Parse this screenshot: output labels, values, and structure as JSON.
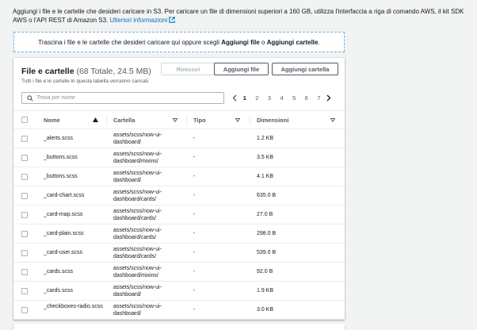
{
  "intro": {
    "text": "Aggiungi i file e le cartelle che desideri caricare in S3. Per caricare un file di dimensioni superiori a 160 GB, utilizza l'interfaccia a riga di comando AWS, il kit SDK AWS o l'API REST di Amazon S3.",
    "link": "Ulteriori informazioni"
  },
  "dropzone": {
    "before": "Trascina i file e le cartelle che desideri caricare qui oppure scegli ",
    "bold1": "Aggiungi file",
    "middle": " o ",
    "bold2": "Aggiungi cartelle",
    "after": "."
  },
  "panel": {
    "title": "File e cartelle",
    "count": "(68 Totale, 24.5 MB)",
    "description": "Tutti i file e le cartelle in questa tabella verranno caricati.",
    "remove_label": "Rimuovi",
    "add_files_label": "Aggiungi file",
    "add_folder_label": "Aggiungi cartella"
  },
  "search": {
    "placeholder": "Trova per nome"
  },
  "pagination": {
    "pages": [
      "1",
      "2",
      "3",
      "4",
      "5",
      "6",
      "7"
    ],
    "current": "1"
  },
  "table": {
    "headers": {
      "name": "Nome",
      "folder": "Cartella",
      "type": "Tipo",
      "size": "Dimensioni"
    },
    "rows": [
      {
        "name": "_alerts.scss",
        "folder": "assets/scss/now-ui-dashboard/",
        "type": "-",
        "size": "1.2 KB"
      },
      {
        "name": "_buttons.scss",
        "folder": "assets/scss/now-ui-dashboard/mixins/",
        "type": "-",
        "size": "3.5 KB"
      },
      {
        "name": "_buttons.scss",
        "folder": "assets/scss/now-ui-dashboard/",
        "type": "-",
        "size": "4.1 KB"
      },
      {
        "name": "_card-chart.scss",
        "folder": "assets/scss/now-ui-dashboard/cards/",
        "type": "-",
        "size": "635.0 B"
      },
      {
        "name": "_card-map.scss",
        "folder": "assets/scss/now-ui-dashboard/cards/",
        "type": "-",
        "size": "27.0 B"
      },
      {
        "name": "_card-plain.scss",
        "folder": "assets/scss/now-ui-dashboard/cards/",
        "type": "-",
        "size": "298.0 B"
      },
      {
        "name": "_card-user.scss",
        "folder": "assets/scss/now-ui-dashboard/cards/",
        "type": "-",
        "size": "539.0 B"
      },
      {
        "name": "_cards.scss",
        "folder": "assets/scss/now-ui-dashboard/mixins/",
        "type": "-",
        "size": "92.0 B"
      },
      {
        "name": "_cards.scss",
        "folder": "assets/scss/now-ui-dashboard/",
        "type": "-",
        "size": "1.9 KB"
      },
      {
        "name": "_checkboxes-radio.scss",
        "folder": "assets/scss/now-ui-dashboard/",
        "type": "-",
        "size": "3.0 KB"
      }
    ]
  },
  "colors": {
    "link": "#0073bb",
    "dropzone_border": "#6fb1e3",
    "text": "#16191f",
    "muted": "#545b64"
  }
}
